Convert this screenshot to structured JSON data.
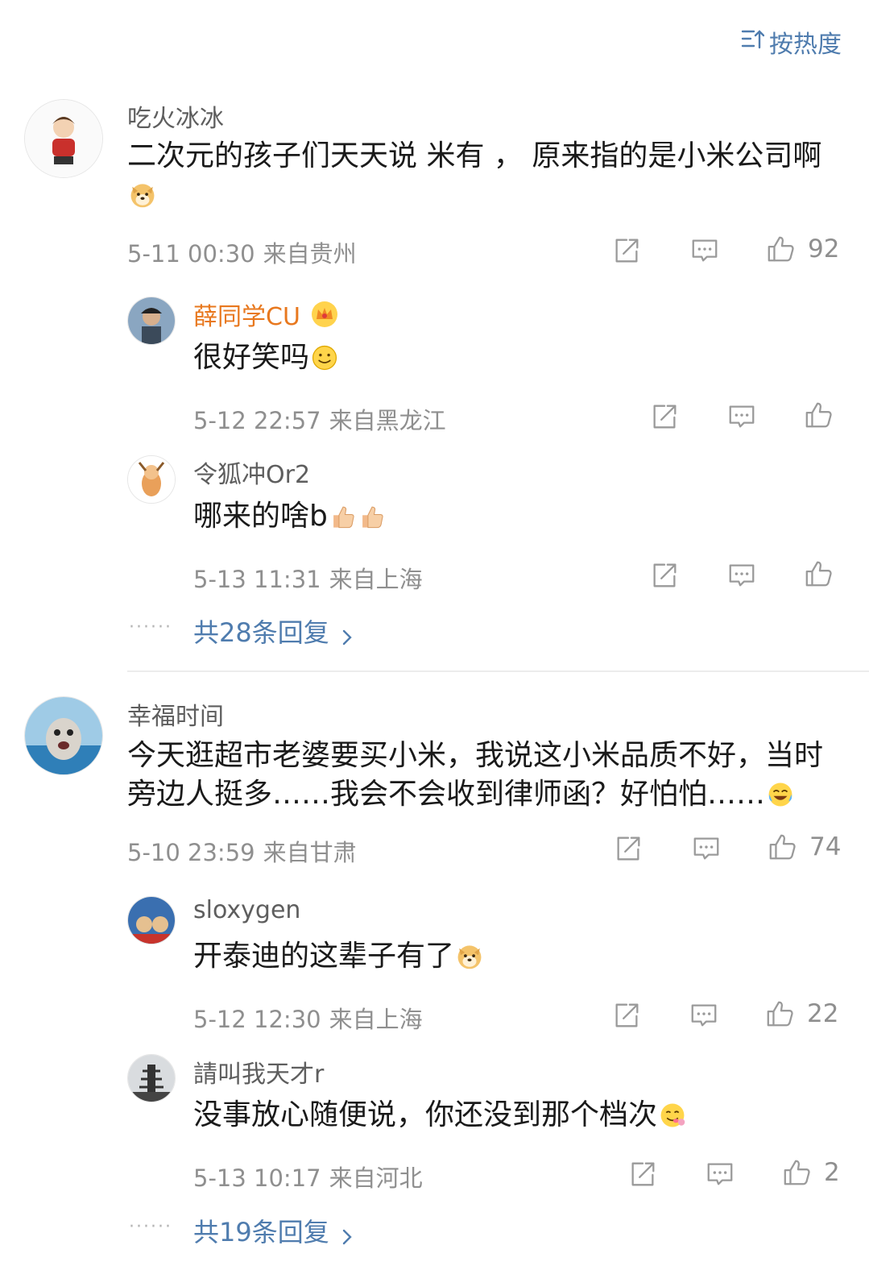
{
  "sort": {
    "label": "按热度",
    "icon": "sort-icon"
  },
  "threads": [
    {
      "author": "吃火冰冰",
      "text": "二次元的孩子们天天说 米有 ， 原来指的是小米公司啊",
      "emoji": "doge-emoji",
      "time": "5-11 00:30",
      "source": "来自贵州",
      "likes": "92",
      "replies": [
        {
          "author": "薛同学CU",
          "badge": "crown-badge-icon",
          "text": "很好笑吗",
          "emoji": "smile-emoji",
          "time": "5-12 22:57",
          "source": "来自黑龙江",
          "likes": ""
        },
        {
          "author": "令狐冲Or2",
          "text": "哪来的啥b",
          "emoji": "thumbs-up-emoji",
          "time": "5-13 11:31",
          "source": "来自上海",
          "likes": ""
        }
      ],
      "more_replies": "共28条回复",
      "more_dots": "······"
    },
    {
      "author": "幸福时间",
      "text": "今天逛超市老婆要买小米，我说这小米品质不好，当时旁边人挺多……我会不会收到律师函？好怕怕……",
      "emoji": "laugh-cry-emoji",
      "time": "5-10 23:59",
      "source": "来自甘肃",
      "likes": "74",
      "replies": [
        {
          "author": "sloxygen",
          "text": "开泰迪的这辈子有了",
          "emoji": "doge-emoji",
          "time": "5-12 12:30",
          "source": "来自上海",
          "likes": "22"
        },
        {
          "author": "請叫我天才r",
          "text": "没事放心随便说，你还没到那个档次",
          "emoji": "yummy-emoji",
          "time": "5-13 10:17",
          "source": "来自河北",
          "likes": "2"
        }
      ],
      "more_replies": "共19条回复",
      "more_dots": "······"
    }
  ],
  "colors": {
    "link": "#4f7cae",
    "vip_name": "#e8781e",
    "meta": "#8f8f8f",
    "icon": "#9a9a9a"
  }
}
